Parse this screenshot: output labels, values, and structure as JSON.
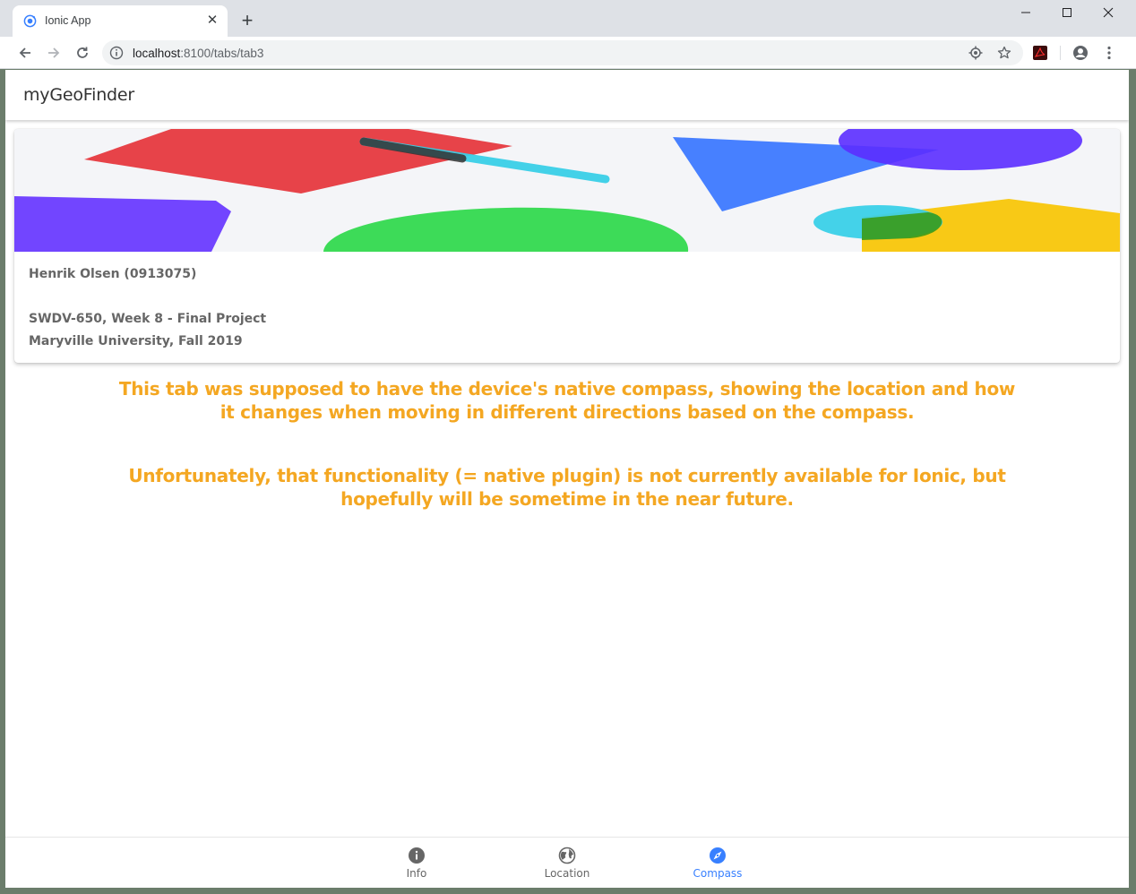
{
  "browser": {
    "tab_title": "Ionic App",
    "url_host": "localhost",
    "url_rest": ":8100/tabs/tab3"
  },
  "app": {
    "title": "myGeoFinder"
  },
  "card": {
    "line1": "Henrik Olsen (0913075)",
    "line2": "SWDV-650, Week 8 - Final Project",
    "line3": "Maryville University, Fall 2019"
  },
  "messages": {
    "first": "This tab was supposed to have the device's native compass, showing the location and how it changes when moving in different directions based on the compass.",
    "second": "Unfortunately, that functionality (= native plugin) is not currently available for Ionic, but hopefully will be sometime in the near future."
  },
  "tabbar": {
    "info_label": "Info",
    "location_label": "Location",
    "compass_label": "Compass"
  },
  "colors": {
    "accent": "#3880ff",
    "message": "#f4a722",
    "inactive_tab": "#666666"
  }
}
